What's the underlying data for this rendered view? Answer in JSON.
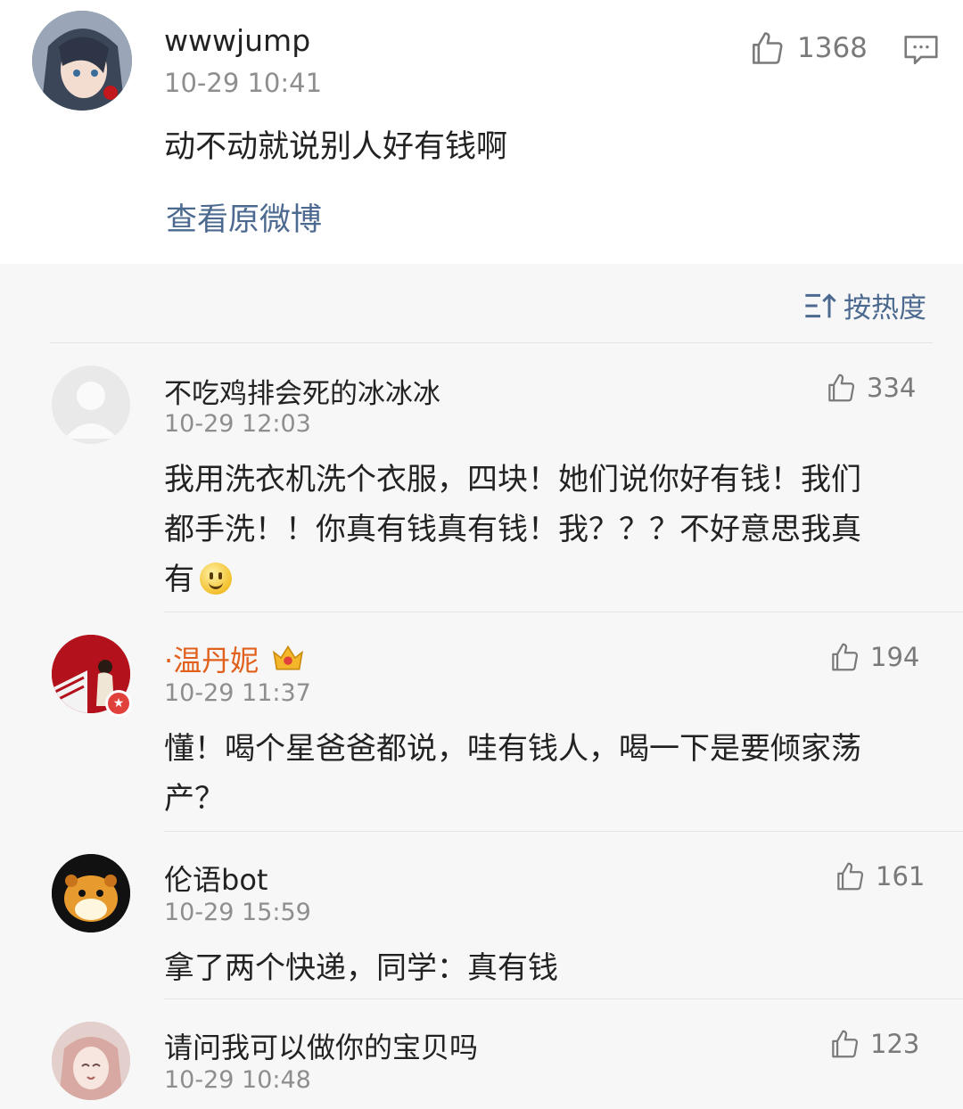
{
  "post": {
    "username": "wwwjump",
    "time": "10-29 10:41",
    "likes": "1368",
    "content": "动不动就说别人好有钱啊",
    "view_original": "查看原微博"
  },
  "sort_label": "按热度",
  "comments": [
    {
      "username": "不吃鸡排会死的冰冰冰",
      "time": "10-29 12:03",
      "likes": "334",
      "lines": [
        "我用洗衣机洗个衣服，四块！她们说你好有钱！我们",
        "都手洗！！你真有钱真有钱！我？？？不好意思我真",
        "有"
      ]
    },
    {
      "username": "·温丹妮",
      "time": "10-29 11:37",
      "likes": "194",
      "lines": [
        "懂！喝个星爸爸都说，哇有钱人，喝一下是要倾家荡",
        "产？"
      ]
    },
    {
      "username": "伦语bot",
      "time": "10-29 15:59",
      "likes": "161",
      "lines": [
        "拿了两个快递，同学：真有钱"
      ]
    },
    {
      "username": "请问我可以做你的宝贝吗",
      "time": "10-29 10:48",
      "likes": "123",
      "lines": []
    }
  ],
  "icons": {
    "like": "thumbs-up-icon",
    "comment": "comment-icon",
    "sort": "sort-icon",
    "crown": "crown-icon",
    "emoji": "smile-emoji-icon"
  },
  "colors": {
    "link": "#4c6a8f",
    "muted": "#8e8e8e",
    "background": "#f7f7f7"
  }
}
